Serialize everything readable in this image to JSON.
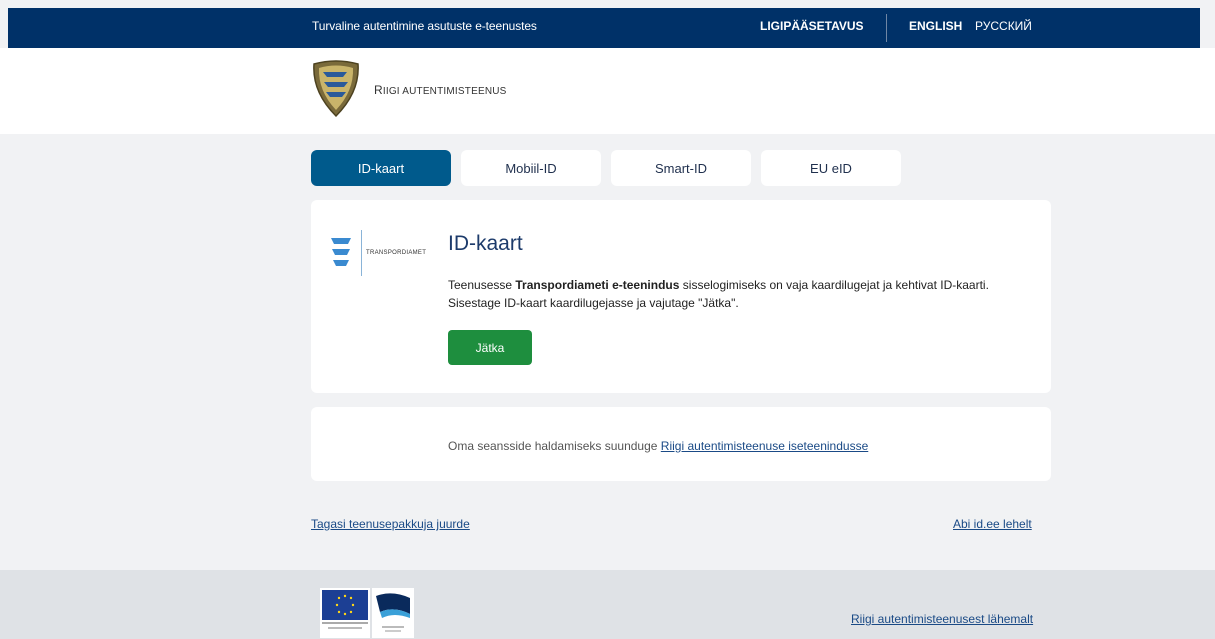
{
  "topbar": {
    "tagline": "Turvaline autentimine asutuste e-teenustes",
    "accessibility": "LIGIPÄÄSETAVUS",
    "lang_english": "ENGLISH",
    "lang_russian": "РУССКИЙ",
    "background": "#003168"
  },
  "header": {
    "brand_first": "R",
    "brand_rest": "IIGI AUTENTIMISTEENUS"
  },
  "tabs": [
    {
      "label": "ID-kaart",
      "active": true
    },
    {
      "label": "Mobiil-ID",
      "active": false
    },
    {
      "label": "Smart-ID",
      "active": false
    },
    {
      "label": "EU eID",
      "active": false
    }
  ],
  "main_card": {
    "logo_name": "TRANSPORDIAMET",
    "title": "ID-kaart",
    "desc_pre": "Teenusesse ",
    "desc_service": "Transpordiameti e-teenindus",
    "desc_post": " sisselogimiseks on vaja kaardilugejat ja kehtivat ID-kaarti. Sisestage ID-kaart kaardilugejasse ja vajutage \"Jätka\".",
    "continue_label": "Jätka",
    "button_color": "#1e8e3e"
  },
  "session_card": {
    "text": "Oma seansside haldamiseks suunduge ",
    "link": "Riigi autentimisteenuse iseteenindusse"
  },
  "links": {
    "back": "Tagasi teenusepakkuja juurde",
    "help": "Abi id.ee lehelt"
  },
  "footer": {
    "about": "Riigi autentimisteenusest lähemalt"
  },
  "colors": {
    "accent": "#005a8c",
    "link": "#1a4a86"
  }
}
